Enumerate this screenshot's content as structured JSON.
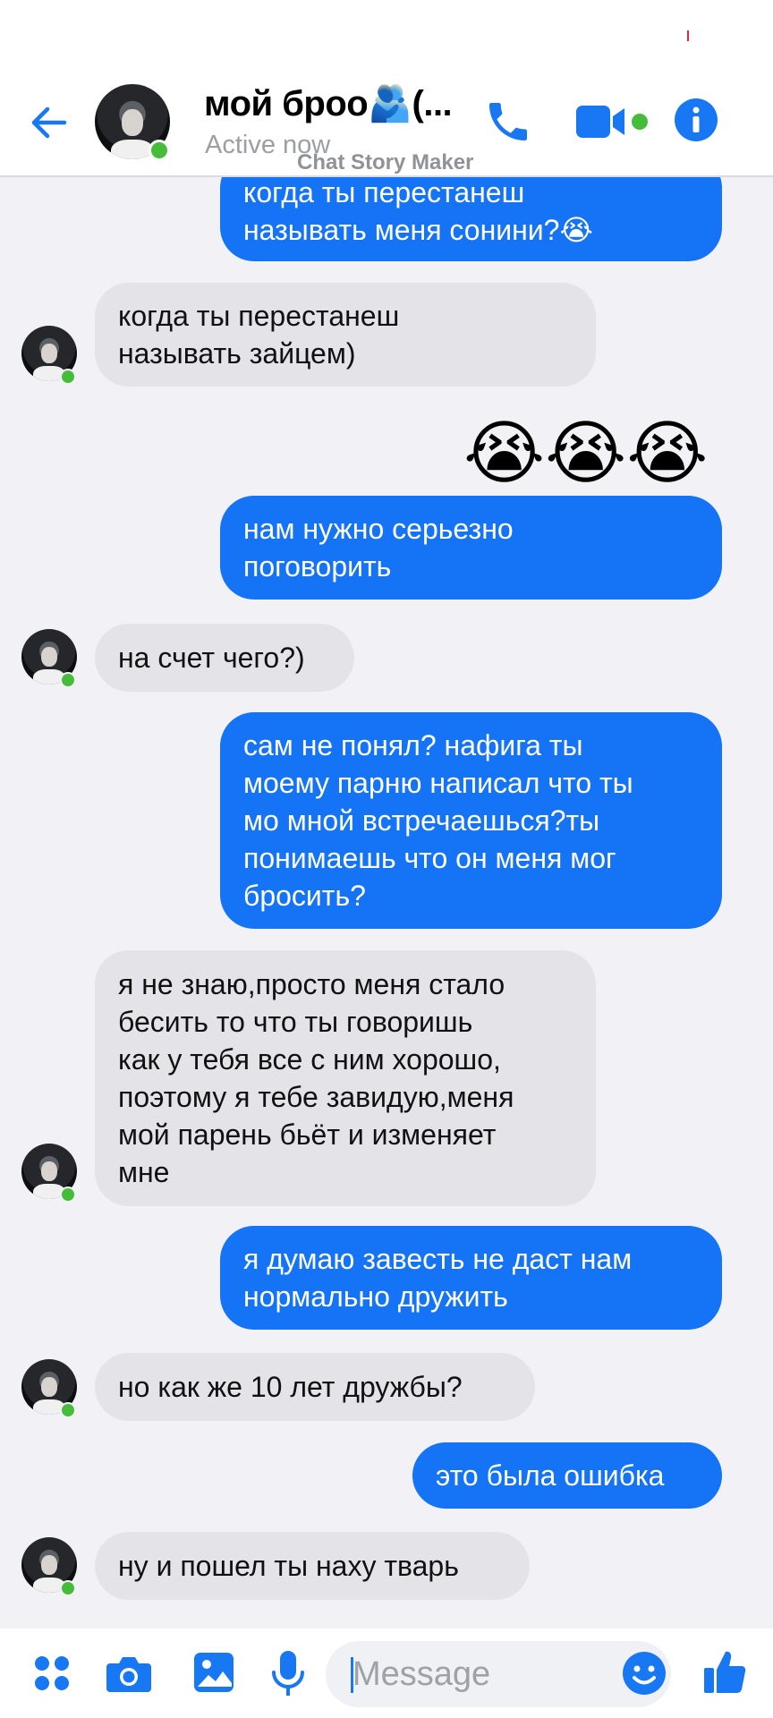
{
  "header": {
    "contact_name": "мой броо🫂(...",
    "status": "Active now",
    "watermark": "Chat Story Maker"
  },
  "colors": {
    "accent": "#1877f2",
    "outgoing_bubble": "#1573f6",
    "incoming_bubble": "#e3e3e8",
    "online": "#45bd3a",
    "chat_background": "#f2f2f6"
  },
  "messages": [
    {
      "side": "out",
      "text": "когда ты перестанеш\nназывать меня сонини?😭"
    },
    {
      "side": "in",
      "text": "когда ты перестанеш\nназывать зайцем)"
    },
    {
      "side": "out",
      "text": "😭😭😭"
    },
    {
      "side": "out",
      "text": "нам нужно серьезно\nпоговорить"
    },
    {
      "side": "in",
      "text": "на счет чего?)"
    },
    {
      "side": "out",
      "text": "сам не понял? нафига ты\nмоему парню написал что ты\nмо мной встречаешься?ты\nпонимаешь что он меня мог\nбросить?"
    },
    {
      "side": "in",
      "text": "я не знаю,просто меня стало\nбесить то что ты говоришь\nкак у тебя все с ним хорошо,\nпоэтому я тебе завидую,меня\nмой парень бьёт и изменяет\nмне"
    },
    {
      "side": "out",
      "text": "я думаю завесть не даст нам\nнормально дружить"
    },
    {
      "side": "in",
      "text": "но как же 10 лет дружбы?"
    },
    {
      "side": "out",
      "text": "это была ошибка"
    },
    {
      "side": "in",
      "text": "ну и пошел ты наху тварь"
    }
  ],
  "composer": {
    "placeholder": "Message",
    "icons": [
      "apps-icon",
      "camera-icon",
      "image-icon",
      "microphone-icon",
      "emoji-icon",
      "like-icon"
    ]
  }
}
